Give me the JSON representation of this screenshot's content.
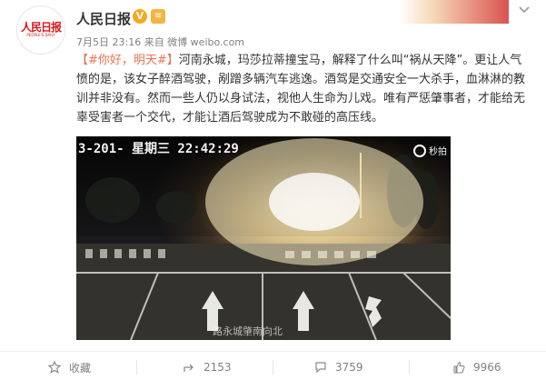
{
  "account": {
    "name": "人民日报",
    "vip_symbol": "V",
    "badge_symbol": "≋",
    "logo_text": "人民日报",
    "logo_sub": "PEOPLE'S DAILY",
    "meta": "7月5日 23:16 来自 微博 weibo.com"
  },
  "banner": {
    "text": ""
  },
  "post": {
    "hashtag": "【#你好，明天#】",
    "body": "河南永城，玛莎拉蒂撞宝马，解释了什么叫“祸从天降”。更让人气愤的是，该女子醉酒驾驶，剐蹭多辆汽车逃逸。酒驾是交通安全一大杀手，血淋淋的教训并非没有。然而一些人仍以身试法，视他人生命为儿戏。唯有严惩肇事者，才能给无辜受害者一个交代，才能让酒后驾驶成为不敢碰的高压线。"
  },
  "video": {
    "osd": "3-201- 星期三 22:42:29",
    "watermark": "秒拍",
    "caption": "路永城肇南向北"
  },
  "actions": {
    "favorite": "收藏",
    "forward": "2153",
    "comment": "3759",
    "like": "9966"
  },
  "colors": {
    "hashtag": "#eb7350",
    "text": "#333333",
    "meta": "#808080",
    "vip": "#f7a81c",
    "logo_red": "#d6181e"
  }
}
